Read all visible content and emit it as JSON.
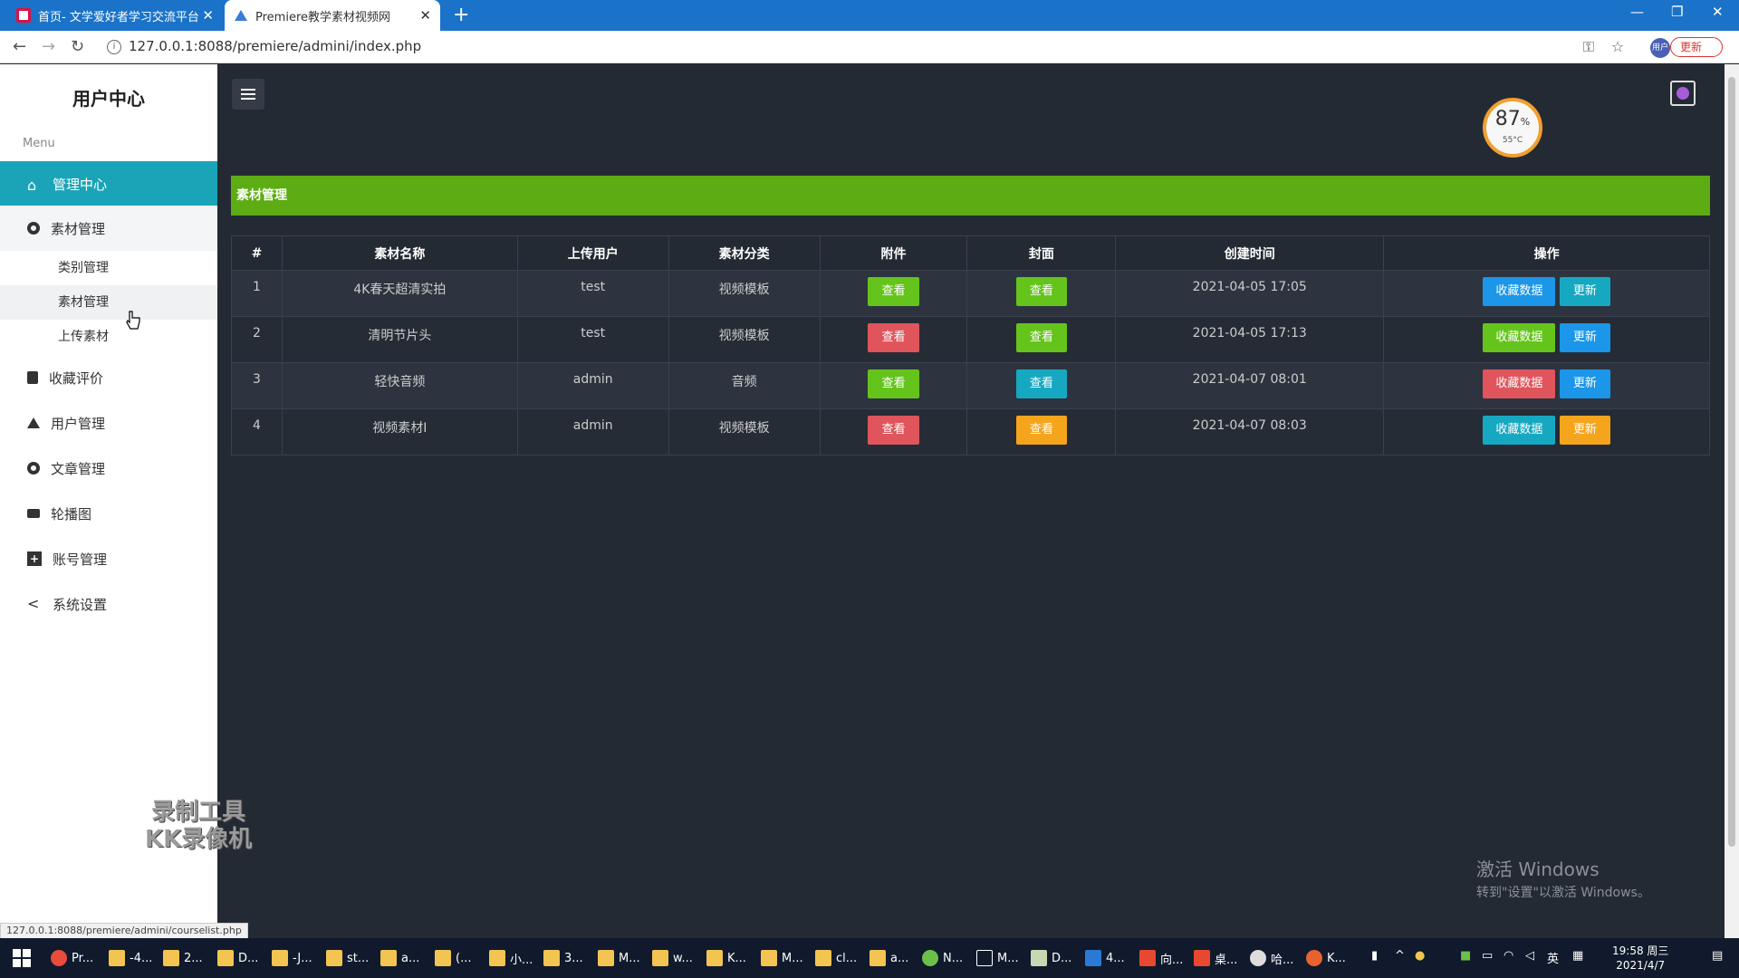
{
  "browser": {
    "tabs": [
      {
        "title": "首页- 文学爱好者学习交流平台"
      },
      {
        "title": "Premiere教学素材视频网"
      }
    ],
    "url": "127.0.0.1:8088/premiere/admini/index.php",
    "update_label": "更新",
    "profile_label": "用户"
  },
  "sidebar": {
    "title": "用户中心",
    "menu_label": "Menu",
    "items": [
      {
        "label": "管理中心",
        "icon": "home-icon"
      },
      {
        "label": "素材管理",
        "icon": "circle-icon"
      },
      {
        "label": "收藏评价",
        "icon": "bookmark-icon"
      },
      {
        "label": "用户管理",
        "icon": "layers-icon"
      },
      {
        "label": "文章管理",
        "icon": "circle-icon"
      },
      {
        "label": "轮播图",
        "icon": "camera-icon"
      },
      {
        "label": "账号管理",
        "icon": "plus-square-icon"
      },
      {
        "label": "系统设置",
        "icon": "share-icon"
      }
    ],
    "subitems": [
      {
        "label": "类别管理"
      },
      {
        "label": "素材管理"
      },
      {
        "label": "上传素材"
      }
    ]
  },
  "watermark": {
    "line1": "录制工具",
    "line2": "KK录像机"
  },
  "gauge": {
    "value": "87",
    "unit": "%",
    "temp": "55°C",
    "color": "#f0a030"
  },
  "banner": {
    "title": "素材管理",
    "color": "#5dac13"
  },
  "table": {
    "headers": [
      "#",
      "素材名称",
      "上传用户",
      "素材分类",
      "附件",
      "封面",
      "创建时间",
      "操作"
    ],
    "rows": [
      {
        "id": "1",
        "name": "4K春天超清实拍",
        "user": "test",
        "category": "视频模板",
        "attach": "查看",
        "cover": "查看",
        "time": "2021-04-05 17:05",
        "collect": "收藏数据",
        "update": "更新"
      },
      {
        "id": "2",
        "name": "清明节片头",
        "user": "test",
        "category": "视频模板",
        "attach": "查看",
        "cover": "查看",
        "time": "2021-04-05 17:13",
        "collect": "收藏数据",
        "update": "更新"
      },
      {
        "id": "3",
        "name": "轻快音频",
        "user": "admin",
        "category": "音频",
        "attach": "查看",
        "cover": "查看",
        "time": "2021-04-07 08:01",
        "collect": "收藏数据",
        "update": "更新"
      },
      {
        "id": "4",
        "name": "视频素材I",
        "user": "admin",
        "category": "视频模板",
        "attach": "查看",
        "cover": "查看",
        "time": "2021-04-07 08:03",
        "collect": "收藏数据",
        "update": "更新"
      }
    ]
  },
  "activate": {
    "line1": "激活 Windows",
    "line2": "转到\"设置\"以激活 Windows。"
  },
  "status_url": "127.0.0.1:8088/premiere/admini/courselist.php",
  "taskbar": {
    "items": [
      "Pr...",
      "-4...",
      "2...",
      "D...",
      "-J...",
      "st...",
      "a...",
      "(...",
      "小...",
      "3...",
      "M...",
      "w...",
      "K...",
      "M...",
      "cl...",
      "a...",
      "N...",
      "M...",
      "D...",
      "4...",
      "向...",
      "桌...",
      "哈...",
      "K..."
    ],
    "ime": "英",
    "time": "19:58 周三",
    "date": "2021/4/7"
  }
}
